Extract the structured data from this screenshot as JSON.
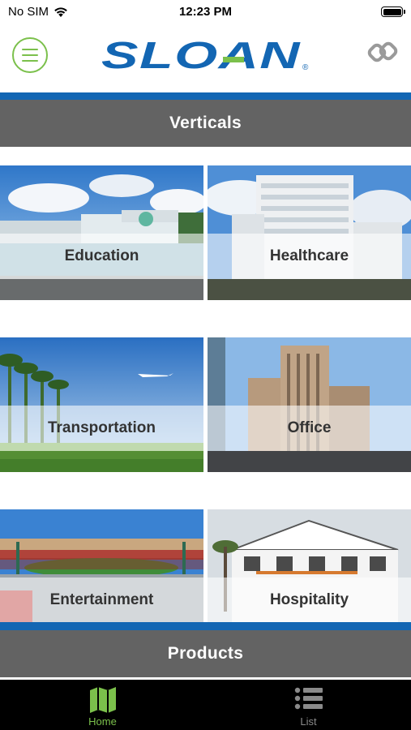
{
  "status_bar": {
    "carrier": "No SIM",
    "time": "12:23 PM",
    "icons": [
      "wifi-icon",
      "battery-icon"
    ]
  },
  "header": {
    "brand": "SLOAN",
    "brand_mark": "®",
    "menu_icon": "hamburger-menu-icon",
    "link_icon": "chain-link-icon",
    "accent_color": "#7bc04b",
    "brand_color": "#1366b3"
  },
  "sections": {
    "verticals_title": "Verticals",
    "products_title": "Products"
  },
  "verticals": [
    {
      "label": "Education"
    },
    {
      "label": "Healthcare"
    },
    {
      "label": "Transportation"
    },
    {
      "label": "Office"
    },
    {
      "label": "Entertainment"
    },
    {
      "label": "Hospitality"
    }
  ],
  "tabs": [
    {
      "label": "Home",
      "icon": "map-icon",
      "active": true
    },
    {
      "label": "List",
      "icon": "list-icon",
      "active": false
    }
  ]
}
